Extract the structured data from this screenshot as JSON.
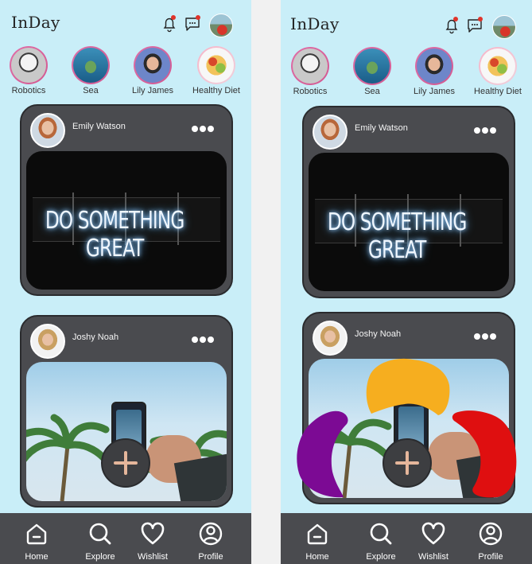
{
  "app": {
    "title": "InDay"
  },
  "header_icons": [
    "bell-icon",
    "chat-icon",
    "avatar"
  ],
  "stories": [
    {
      "label": "Robotics",
      "icon": "robot-image"
    },
    {
      "label": "Sea",
      "icon": "turtle-image"
    },
    {
      "label": "Lily James",
      "icon": "portrait-image"
    },
    {
      "label": "Healthy Diet",
      "icon": "salad-image"
    }
  ],
  "posts": [
    {
      "author": "Emily Watson",
      "image_text": "DO SOMETHING GREAT"
    },
    {
      "author": "Joshy Noah"
    }
  ],
  "nav": [
    {
      "label": "Home",
      "icon": "home-icon"
    },
    {
      "label": "Explore",
      "icon": "search-icon"
    },
    {
      "label": "Wishlist",
      "icon": "heart-icon"
    },
    {
      "label": "Profile",
      "icon": "profile-icon"
    }
  ],
  "colors": {
    "background": "#c9eef8",
    "card": "#4a4b4f",
    "nav": "#4a4b4f",
    "notification_dot": "#e0342b",
    "fab_plus": "#e5b69b",
    "blob_yellow": "#f6ae1f",
    "blob_purple": "#7c0a94",
    "blob_red": "#df0f10"
  }
}
